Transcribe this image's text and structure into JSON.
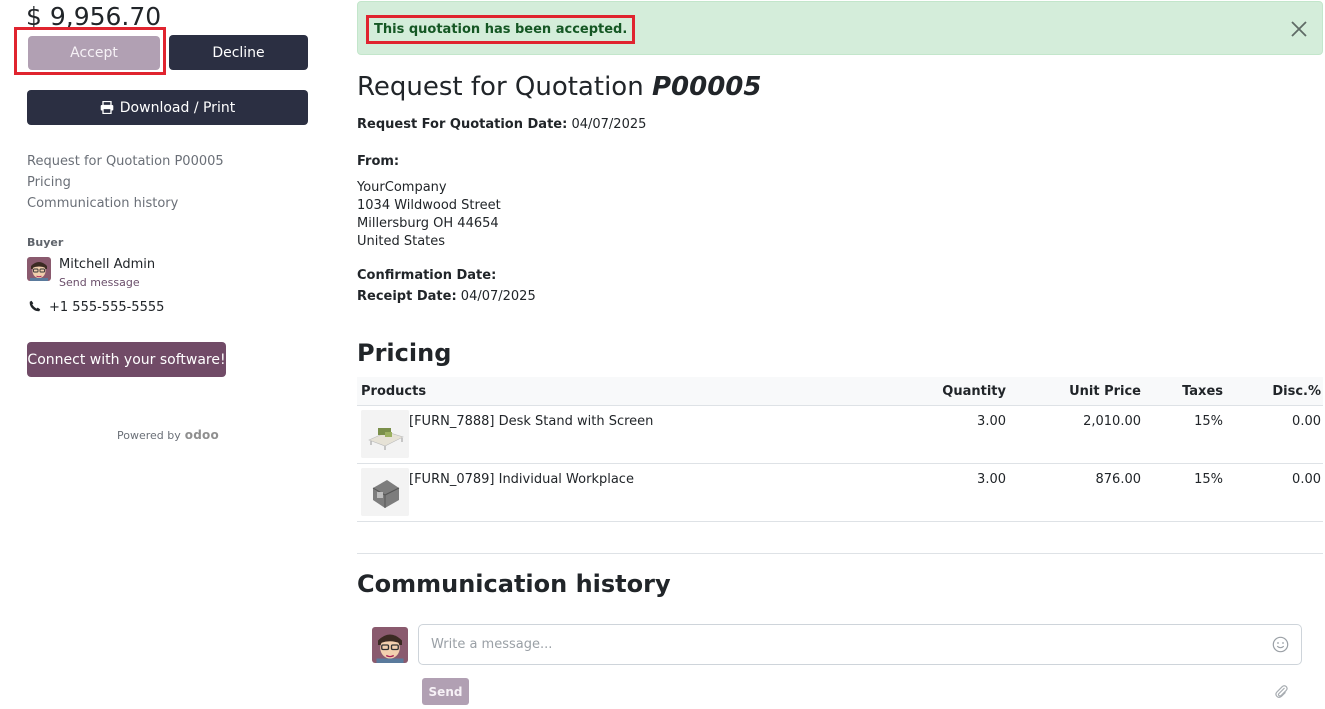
{
  "sidebar": {
    "total": "$ 9,956.70",
    "accept_label": "Accept",
    "decline_label": "Decline",
    "download_label": "Download / Print",
    "nav": [
      {
        "label": "Request for Quotation P00005"
      },
      {
        "label": "Pricing"
      },
      {
        "label": "Communication history"
      }
    ],
    "buyer_label": "Buyer",
    "buyer_name": "Mitchell Admin",
    "send_message": "Send message",
    "phone": "+1 555-555-5555",
    "connect_label": "Connect with your software!",
    "powered_by": "Powered by",
    "powered_brand": "odoo"
  },
  "alert": {
    "text": "This quotation has been accepted."
  },
  "document": {
    "title_prefix": "Request for Quotation",
    "title_ref": "P00005",
    "rfq_date_label": "Request For Quotation Date:",
    "rfq_date": "04/07/2025",
    "from_label": "From:",
    "address": [
      "YourCompany",
      "1034 Wildwood Street",
      "Millersburg OH 44654",
      "United States"
    ],
    "confirmation_label": "Confirmation Date:",
    "receipt_label": "Receipt Date:",
    "receipt_date": "04/07/2025"
  },
  "pricing": {
    "title": "Pricing",
    "headers": {
      "product": "Products",
      "quantity": "Quantity",
      "unit_price": "Unit Price",
      "taxes": "Taxes",
      "discount": "Disc.%"
    },
    "rows": [
      {
        "product": "[FURN_7888] Desk Stand with Screen",
        "quantity": "3.00",
        "unit_price": "2,010.00",
        "taxes": "15%",
        "discount": "0.00"
      },
      {
        "product": "[FURN_0789] Individual Workplace",
        "quantity": "3.00",
        "unit_price": "876.00",
        "taxes": "15%",
        "discount": "0.00"
      }
    ]
  },
  "communication": {
    "title": "Communication history",
    "placeholder": "Write a message...",
    "send_label": "Send"
  },
  "colors": {
    "primary": "#714b67",
    "dark_button": "#2b2f42",
    "alert_bg": "#d4edda",
    "highlight": "#e0242f"
  }
}
